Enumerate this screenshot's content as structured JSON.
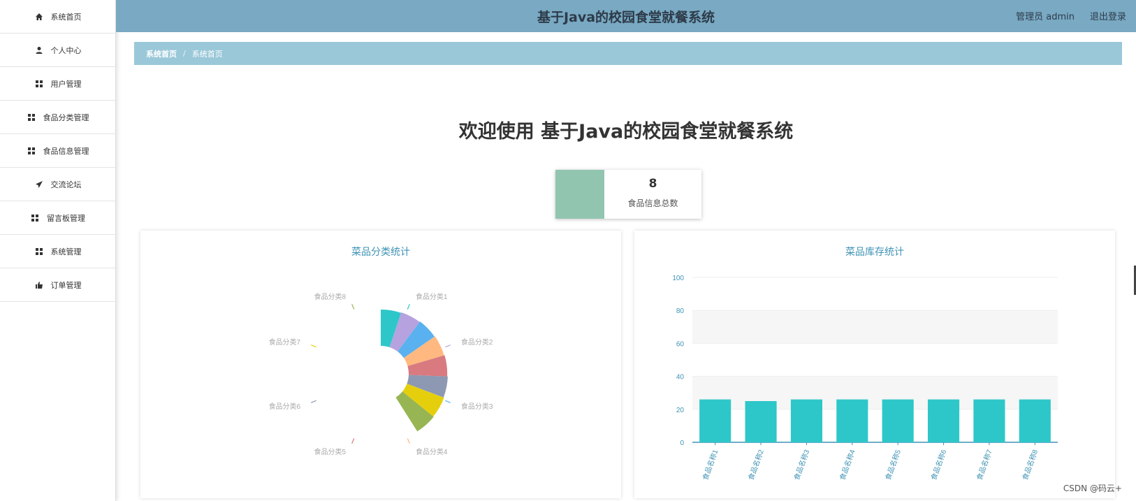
{
  "header": {
    "title": "基于Java的校园食堂就餐系统",
    "user": "管理员 admin",
    "logout": "退出登录"
  },
  "sidebar": {
    "items": [
      {
        "label": "系统首页",
        "icon": "home-icon"
      },
      {
        "label": "个人中心",
        "icon": "user-icon"
      },
      {
        "label": "用户管理",
        "icon": "grid-icon"
      },
      {
        "label": "食品分类管理",
        "icon": "grid-icon"
      },
      {
        "label": "食品信息管理",
        "icon": "grid-icon"
      },
      {
        "label": "交流论坛",
        "icon": "send-icon"
      },
      {
        "label": "留言板管理",
        "icon": "grid-icon"
      },
      {
        "label": "系统管理",
        "icon": "grid-icon"
      },
      {
        "label": "订单管理",
        "icon": "cart-icon"
      }
    ]
  },
  "breadcrumb": {
    "home": "系统首页",
    "separator": "/",
    "current": "系统首页"
  },
  "welcome": "欢迎使用 基于Java的校园食堂就餐系统",
  "stat": {
    "value": "8",
    "label": "食品信息总数",
    "color": "#92c5b0"
  },
  "panels": {
    "left_title": "菜品分类统计",
    "right_title": "菜品库存统计"
  },
  "chart_data": [
    {
      "type": "pie",
      "title": "菜品分类统计",
      "rose": true,
      "categories": [
        "食品分类1",
        "食品分类2",
        "食品分类3",
        "食品分类4",
        "食品分类5",
        "食品分类6",
        "食品分类7",
        "食品分类8"
      ],
      "colors": [
        "#2ec7c9",
        "#b6a2de",
        "#5ab1ef",
        "#ffb980",
        "#d87a80",
        "#8d98b3",
        "#e5cf0d",
        "#97b552"
      ],
      "values": [
        1,
        1,
        1,
        1,
        1,
        1,
        1,
        1
      ]
    },
    {
      "type": "bar",
      "title": "菜品库存统计",
      "categories": [
        "食品名称1",
        "食品名称2",
        "食品名称3",
        "食品名称4",
        "食品名称5",
        "食品名称6",
        "食品名称7",
        "食品名称8"
      ],
      "values": [
        26,
        25,
        26,
        26,
        26,
        26,
        26,
        26
      ],
      "ylim": [
        0,
        100
      ],
      "yticks": [
        0,
        20,
        40,
        60,
        80,
        100
      ],
      "color": "#2ec7c9"
    }
  ],
  "watermark": "CSDN @码云+"
}
